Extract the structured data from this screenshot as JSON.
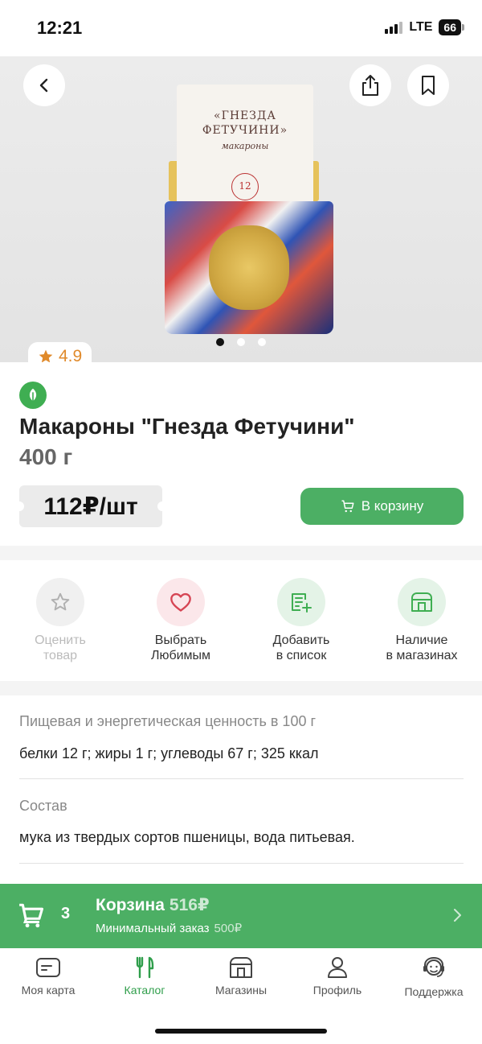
{
  "status_bar": {
    "time": "12:21",
    "network": "LTE",
    "battery": "66"
  },
  "hero": {
    "package_brand": "«ГНЕЗДА\nФЕТУЧИНИ»",
    "package_subtitle": "макароны",
    "package_seal": "12",
    "slides": 3,
    "active_slide": 0
  },
  "rating": {
    "value": "4.9"
  },
  "product": {
    "title": "Макароны \"Гнезда Фетучини\"",
    "weight": "400 г",
    "price": "112₽/шт",
    "add_to_cart_label": "В корзину"
  },
  "actions": [
    {
      "label": "Оценить\nтовар",
      "icon": "star-icon",
      "disabled": true
    },
    {
      "label": "Выбрать\nЛюбимым",
      "icon": "heart-icon",
      "disabled": false
    },
    {
      "label": "Добавить\nв список",
      "icon": "add-to-list-icon",
      "disabled": false
    },
    {
      "label": "Наличие\nв магазинах",
      "icon": "store-icon",
      "disabled": false
    }
  ],
  "details": {
    "nutrition_heading": "Пищевая и энергетическая ценность в 100 г",
    "nutrition_text": "белки 12 г; жиры 1 г; углеводы 67 г; 325 ккал",
    "composition_heading": "Состав",
    "composition_text": "мука из твердых сортов пшеницы, вода питьевая."
  },
  "cart_bar": {
    "count": "3",
    "title": "Корзина",
    "total": "516₽",
    "min_order_label": "Минимальный заказ",
    "min_order_value": "500₽"
  },
  "tabs": [
    {
      "label": "Моя карта",
      "icon": "card-icon",
      "active": false
    },
    {
      "label": "Каталог",
      "icon": "catalog-icon",
      "active": true
    },
    {
      "label": "Магазины",
      "icon": "store-icon",
      "active": false
    },
    {
      "label": "Профиль",
      "icon": "profile-icon",
      "active": false
    },
    {
      "label": "Поддержка",
      "icon": "support-icon",
      "active": false
    }
  ],
  "colors": {
    "accent_green": "#4caf64",
    "active_tab_green": "#2f9e4b",
    "rating_orange": "#e08a2b",
    "heart_red": "#d64554"
  }
}
